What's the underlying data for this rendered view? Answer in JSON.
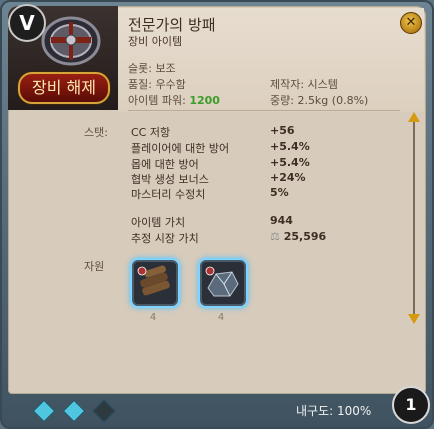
{
  "item": {
    "badge": "V",
    "name": "전문가의 방패",
    "category": "장비 아이템",
    "unequip_label": "장비 해제",
    "slot": "슬롯: 보조",
    "quality": "품질: 우수함",
    "power_label": "아이템 파워:",
    "power_value": "1200",
    "maker": "제작자: 시스템",
    "weight": "중량: 2.5kg (0.8%)"
  },
  "stats": {
    "label": "스탯:",
    "rows": [
      {
        "name": "CC 저항",
        "value": "+56"
      },
      {
        "name": "플레이어에 대한 방어",
        "value": "+5.4%"
      },
      {
        "name": "몹에 대한 방어",
        "value": "+5.4%"
      },
      {
        "name": "협박 생성 보너스",
        "value": "+24%"
      },
      {
        "name": "마스터리 수정치",
        "value": "5%"
      }
    ],
    "value_label": "아이템 가치",
    "value": "944",
    "market_label": "추정 시장 가치",
    "market_value": "25,596"
  },
  "resources": {
    "label": "자원",
    "items": [
      {
        "icon": "lumber-icon",
        "count": "4"
      },
      {
        "icon": "ore-icon",
        "count": "4"
      }
    ]
  },
  "footer": {
    "durability": "내구도: 100%",
    "badge": "1",
    "gems": [
      {
        "color": "#4fc6e0"
      },
      {
        "color": "#4fc6e0"
      },
      {
        "color": "#2d3a3f"
      }
    ]
  },
  "colors": {
    "power": "#3c9d2a",
    "accent": "#d69a12",
    "glow": "#56c1f5"
  }
}
